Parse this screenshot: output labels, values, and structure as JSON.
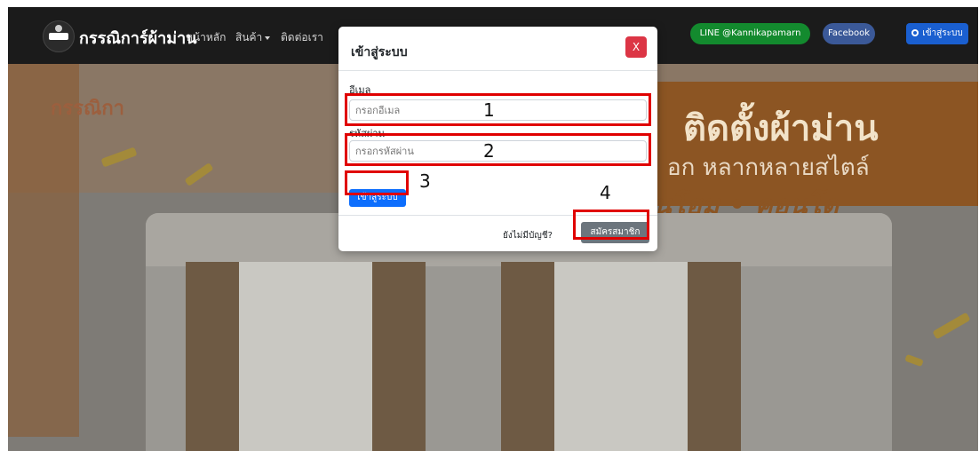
{
  "navbar": {
    "brand": "กรรณิการ์ผ้าม่าน",
    "links": [
      "หน้าหลัก",
      "สินค้า",
      "ติดต่อเรา"
    ],
    "line_button": "LINE @Kannikapamarn",
    "facebook_button": "Facebook",
    "login_button": "เข้าสู่ระบบ"
  },
  "hero": {
    "logo_text": "กรรณิกา",
    "title": "ติดตั้งผ้าม่าน",
    "subtitle": "อก หลากหลายสไตล์",
    "tagline": "นโฮม • คอนโด"
  },
  "modal": {
    "title": "เข้าสู่ระบบ",
    "close_label": "X",
    "email_label": "อีเมล",
    "email_placeholder": "กรอกอีเมล",
    "password_label": "รหัสผ่าน",
    "password_placeholder": "กรอกรหัสผ่าน",
    "submit_label": "เข้าสู่ระบบ",
    "no_account_text": "ยังไม่มีบัญชี?",
    "register_label": "สมัครสมาชิก"
  },
  "annotations": [
    "1",
    "2",
    "3",
    "4"
  ],
  "colors": {
    "navbar": "#1b1b1b",
    "line_green": "#138a2e",
    "facebook_blue": "#3b5998",
    "primary_blue": "#0d6efd",
    "danger_red": "#dc3545",
    "secondary_gray": "#6c757d",
    "annotation_red": "#e00000"
  }
}
